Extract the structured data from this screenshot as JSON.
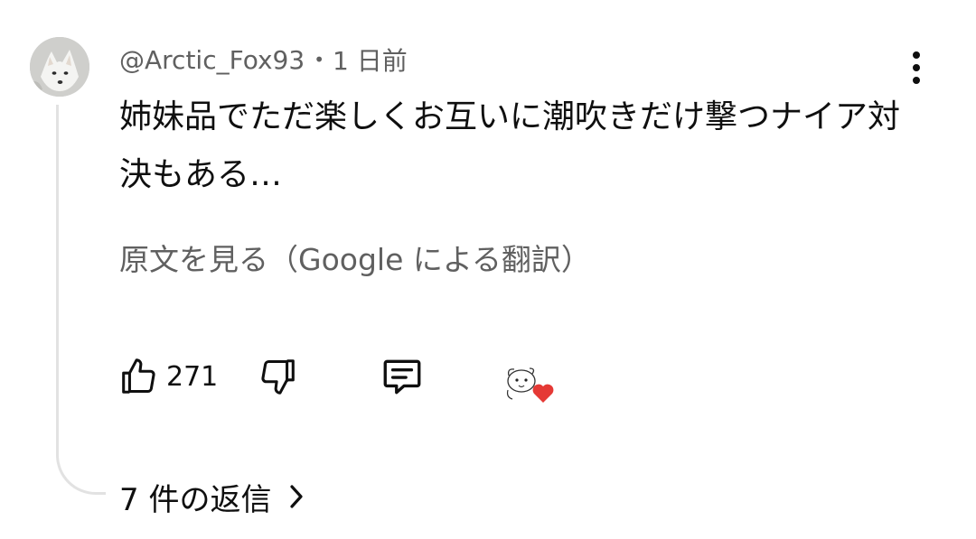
{
  "comment": {
    "author": "@Arctic_Fox93",
    "separator": "•",
    "timestamp": "1 日前",
    "text": "姉妹品でただ楽しくお互いに潮吹きだけ撃つナイア対決もある…",
    "translate_link": "原文を見る（Google による翻訳）",
    "avatar_icon": "arctic-fox-avatar",
    "menu_icon": "more-vertical-icon"
  },
  "actions": {
    "like_icon": "thumbs-up-icon",
    "like_count": "271",
    "dislike_icon": "thumbs-down-icon",
    "reply_icon": "reply-comment-icon",
    "creator_heart_icon": "creator-heart-icon",
    "heart_color": "#e53935"
  },
  "replies": {
    "label": "7 件の返信",
    "chevron_icon": "chevron-right-icon"
  },
  "colors": {
    "primary_text": "#0f0f0f",
    "secondary_text": "#606060",
    "thread_line": "#e2e2e2",
    "background": "#ffffff"
  }
}
